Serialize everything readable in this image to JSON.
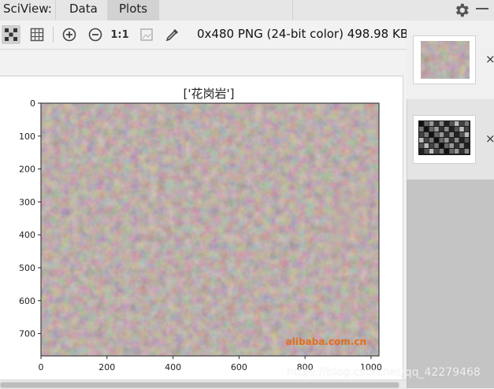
{
  "tabbar": {
    "app_label": "SciView:",
    "tab_data": "Data",
    "tab_plots": "Plots"
  },
  "toolbar": {
    "actual_size_label": "1:1",
    "image_info": "0x480 PNG (24-bit color) 498.98 KB"
  },
  "plot": {
    "title": "['花岗岩']",
    "x_ticks": [
      "0",
      "200",
      "400",
      "600",
      "800",
      "1000"
    ],
    "y_ticks": [
      "0",
      "100",
      "200",
      "300",
      "400",
      "500",
      "600",
      "700"
    ],
    "x_range": [
      0,
      1024
    ],
    "y_range": [
      0,
      768
    ],
    "image_watermark": "alibaba.com.cn",
    "texture_color": "#7e6a66",
    "image_name": "granite-texture"
  },
  "thumbnails": {
    "close_glyph": "×",
    "items": [
      {
        "name": "granite-plot",
        "color": "#7e6a66"
      },
      {
        "name": "grayscale-grid-plot",
        "color": "#2a2a2a"
      }
    ]
  },
  "watermark": "https://blog.csdn.net/qq_42279468",
  "colors": {
    "active_tab": "#d2d2d2",
    "panel_bg": "#f2f2f2",
    "thumbs_bg": "#c4c4c4"
  }
}
